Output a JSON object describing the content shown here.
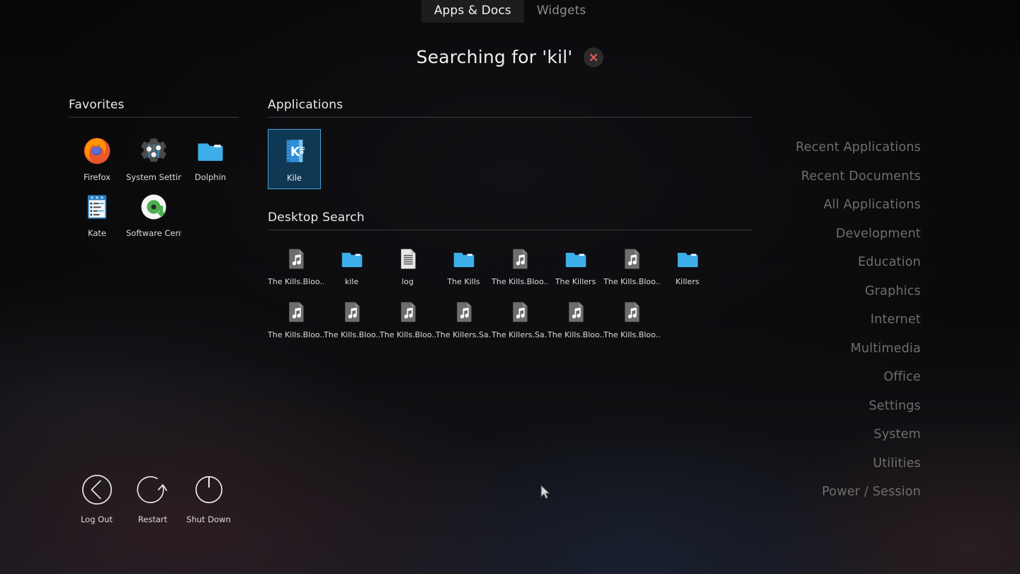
{
  "tabs": [
    {
      "label": "Apps & Docs",
      "active": true
    },
    {
      "label": "Widgets",
      "active": false
    }
  ],
  "search": {
    "title": "Searching for 'kil'",
    "query": "kil",
    "clear_icon": "close-x-icon",
    "clear_color": "#e35d5d"
  },
  "favorites": {
    "title": "Favorites",
    "items": [
      {
        "label": "Firefox",
        "icon": "firefox-icon"
      },
      {
        "label": "System Settings",
        "icon": "system-settings-gear-icon"
      },
      {
        "label": "Dolphin",
        "icon": "folder-icon"
      },
      {
        "label": "Kate",
        "icon": "kate-text-editor-icon"
      },
      {
        "label": "Software Cent...",
        "icon": "software-center-disc-icon"
      }
    ]
  },
  "applications": {
    "title": "Applications",
    "items": [
      {
        "label": "Kile",
        "icon": "kile-icon",
        "selected": true
      }
    ]
  },
  "desktop_search": {
    "title": "Desktop Search",
    "items": [
      {
        "label": "The Kills.Bloo...",
        "icon": "audio-file-icon"
      },
      {
        "label": "kile",
        "icon": "folder-icon"
      },
      {
        "label": "log",
        "icon": "text-document-icon"
      },
      {
        "label": "The Kills",
        "icon": "folder-icon"
      },
      {
        "label": "The Kills.Bloo...",
        "icon": "audio-file-icon"
      },
      {
        "label": "The Killers",
        "icon": "folder-icon"
      },
      {
        "label": "The Kills.Bloo...",
        "icon": "audio-file-icon"
      },
      {
        "label": "Killers",
        "icon": "folder-icon"
      },
      {
        "label": "The Kills.Bloo...",
        "icon": "audio-file-icon"
      },
      {
        "label": "The Kills.Bloo...",
        "icon": "audio-file-icon"
      },
      {
        "label": "The Kills.Bloo...",
        "icon": "audio-file-icon"
      },
      {
        "label": "The Killers.Sa...",
        "icon": "audio-file-icon"
      },
      {
        "label": "The Killers.Sa...",
        "icon": "audio-file-icon"
      },
      {
        "label": "The Kills.Bloo...",
        "icon": "audio-file-icon"
      },
      {
        "label": "The Kills.Bloo...",
        "icon": "audio-file-icon"
      }
    ]
  },
  "categories": [
    {
      "label": "Recent Applications"
    },
    {
      "label": "Recent Documents"
    },
    {
      "label": "All Applications"
    },
    {
      "label": "Development"
    },
    {
      "label": "Education"
    },
    {
      "label": "Graphics"
    },
    {
      "label": "Internet"
    },
    {
      "label": "Multimedia"
    },
    {
      "label": "Office"
    },
    {
      "label": "Settings"
    },
    {
      "label": "System"
    },
    {
      "label": "Utilities"
    },
    {
      "label": "Power / Session"
    }
  ],
  "session": [
    {
      "label": "Log Out",
      "icon": "logout-back-arrow-icon"
    },
    {
      "label": "Restart",
      "icon": "restart-circular-arrow-icon"
    },
    {
      "label": "Shut Down",
      "icon": "power-icon"
    }
  ],
  "colors": {
    "accent_blue": "#3daee9",
    "selection_bg": "#0f3854",
    "selection_border": "#4a9fd4",
    "folder_blue": "#3daee9",
    "audio_gray": "#6e6e6e",
    "category_text": "#6e6e6e",
    "background": "#0a0a0b"
  }
}
